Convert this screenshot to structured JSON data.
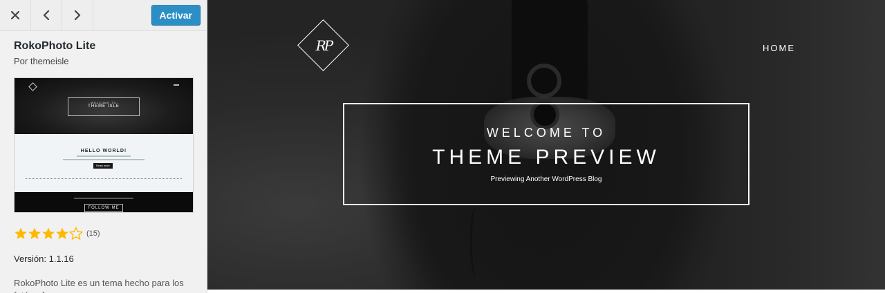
{
  "toolbar": {
    "close_icon": "close-icon",
    "previous_icon": "chevron-left-icon",
    "next_icon": "chevron-right-icon",
    "activate_label": "Activar"
  },
  "theme": {
    "name": "RokoPhoto Lite",
    "author": "Por themeisle",
    "rating": {
      "stars": 4,
      "max_stars": 5,
      "count": "(15)"
    },
    "version": "Versión: 1.1.16",
    "description": "RokoPhoto Lite es un tema hecho para los fotógrafos"
  },
  "thumbnail": {
    "hero_small": "WELCOME TO",
    "hero_big": "THEME ISLE",
    "body_title": "HELLO WORLD!",
    "read_more": "Read more",
    "follow": "FOLLOW ME"
  },
  "preview": {
    "logo_text": "RP",
    "nav_home": "HOME",
    "welcome": "WELCOME TO",
    "title": "THEME PREVIEW",
    "subtitle": "Previewing Another WordPress Blog"
  },
  "colors": {
    "activate_button": "#2b8fc6",
    "star": "#ffb900",
    "sidebar_bg": "#f1f1f1",
    "preview_bg": "#2a2a2a"
  }
}
